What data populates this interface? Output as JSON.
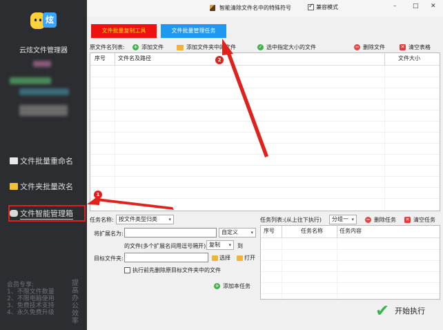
{
  "window": {
    "title": "智能清除文件名中的特殊符号",
    "compat_label": "兼容模式",
    "compat_checked": true,
    "min_symbol": "–",
    "max_symbol": "□",
    "close_symbol": "✕"
  },
  "sidebar": {
    "app_name": "云炫文件管理器",
    "logo_text": "炫",
    "items": [
      {
        "label": "文件批量重命名"
      },
      {
        "label": "文件夹批量改名"
      },
      {
        "label": "文件智能管理箱"
      }
    ],
    "promo_lines": "会员专享:\n1、不限文件数量\n2、不限电脑使用\n3、免费技术支持\n4、永久免费升级",
    "promo_vertical": "提高办公效率"
  },
  "tabs": {
    "copy_tool": "文件批量复制工具",
    "manage_task": "文件批量管理任务"
  },
  "file_list": {
    "label": "原文件名列表:",
    "add_file": "添加文件",
    "add_folder_files": "添加文件夹中的文件",
    "select_by_size": "选中指定大小的文件",
    "delete_file": "删除文件",
    "clear_table": "清空表格",
    "columns": [
      "序号",
      "文件名及路径",
      "文件大小"
    ]
  },
  "task": {
    "name_label": "任务名称:",
    "name_value": "按文件类型归类",
    "ext_label": "将扩展名为:",
    "ext_mode": "自定义",
    "ext_hint": "的文件(多个扩展名间用逗号隔开)",
    "action": "复制",
    "to": "到",
    "target_label": "目标文件夹:",
    "choose": "选择",
    "open": "打开",
    "pre_delete": "执行前先删除原目标文件夹中的文件",
    "add_task": "添加本任务"
  },
  "task_list": {
    "label": "任务列表:(从上往下执行)",
    "group": "分组一",
    "delete_task": "删除任务",
    "clear_task": "清空任务",
    "columns": [
      "序号",
      "任务名称",
      "任务内容"
    ],
    "start": "开始执行"
  },
  "annotations": {
    "badge1": "1",
    "badge2": "2"
  },
  "colors": {
    "red_tab": "#ef1010",
    "blue_tab": "#1f98f0",
    "annotation": "#e0221c",
    "sidebar_bg": "#2b2d31"
  }
}
